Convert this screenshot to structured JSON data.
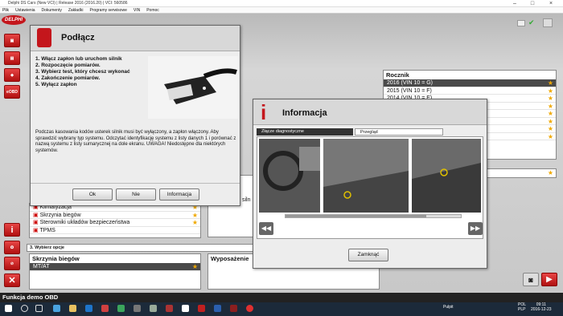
{
  "window": {
    "title": "Delphi DS Cars (New VCI) | Release 2016 (2016.20) | VCI: 560586"
  },
  "menu": [
    "Plik",
    "Ustawienia",
    "Dokumenty",
    "Zakładki",
    "Programy serwisowe",
    "VIN",
    "Pomoc"
  ],
  "logo": "DELPHI",
  "sidebar": {
    "ecobd_label": "eOBD",
    "info": "i"
  },
  "year": {
    "header": "Rocznik",
    "items": [
      "2016 (VIN 10 = G)",
      "2015 (VIN 10 = F)",
      "2014 (VIN 10 = E)"
    ]
  },
  "systems": {
    "items": [
      "Klimatyzacja",
      "Skrzynia biegów",
      "Sterowniki układów bezpieczeństwa",
      "TPMS"
    ]
  },
  "step3": {
    "tab": "3. Wybierz opcje",
    "gearbox_header": "Skrzynia biegów",
    "gearbox_value": "MT/AT",
    "equipment_header": "Wyposażenie",
    "partial_text": "siln"
  },
  "connect": {
    "title": "Podłącz",
    "steps": [
      "1. Włącz zapłon lub uruchom silnik",
      "2. Rozpoczęcie pomiarów.",
      "3. Wybierz test, który chcesz wykonać",
      "4. Zakończenie pomiarów.",
      "5. Wyłącz zapłon"
    ],
    "body": "Podczas kasowania kodów usterek silnik musi być wyłączony, a zapłon włączony. Aby sprawdzić wybrany typ systemu. Odczytać identyfikację systemu z listy danych 1 i porównać z nazwą systemu z listy sumarycznej na dole ekranu. UWAGA! Niedostępne dla niektórych systemów.",
    "ok": "Ok",
    "no": "Nie",
    "info": "Informacja"
  },
  "info": {
    "title": "Informacja",
    "tab1": "Złącze diagnostyczne",
    "tab2": "Przegląd",
    "close": "Zamknąć"
  },
  "status": "Funkcja demo OBD",
  "clock": {
    "time": "09:11",
    "date": "2016-12-23",
    "lang": "POL",
    "kbd": "PLP",
    "user": "Pulpit"
  }
}
